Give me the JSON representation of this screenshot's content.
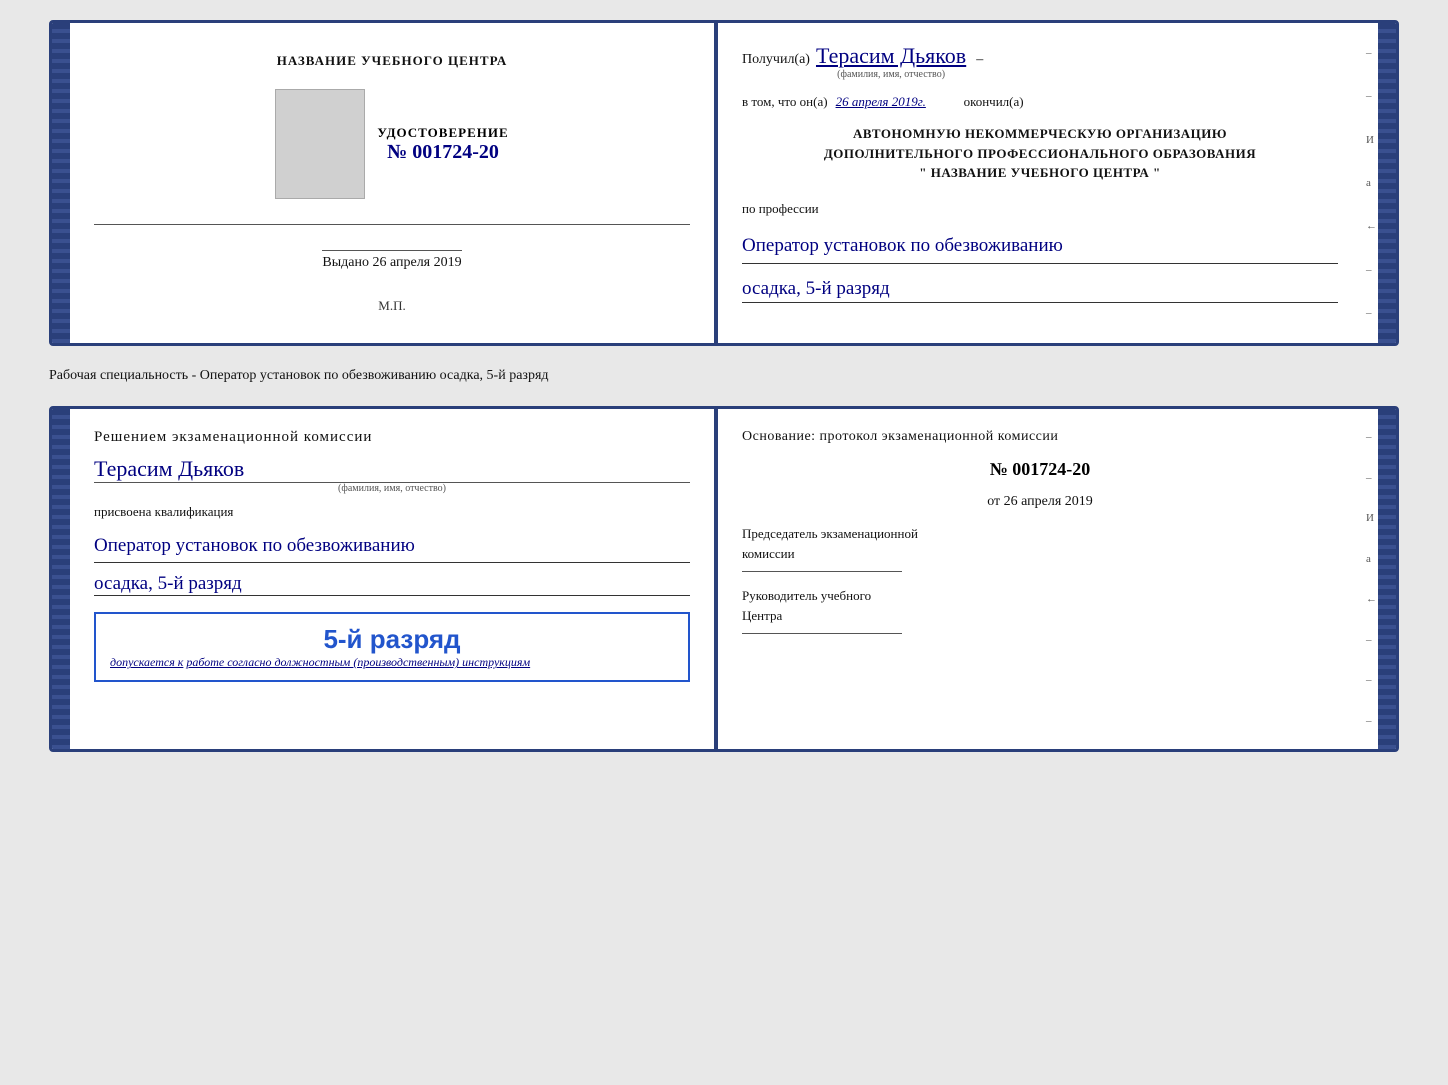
{
  "top_doc": {
    "left": {
      "center_title": "НАЗВАНИЕ УЧЕБНОГО ЦЕНТРА",
      "udost_label": "УДОСТОВЕРЕНИЕ",
      "udost_number": "№ 001724-20",
      "vydano_prefix": "Выдано",
      "vydano_date": "26 апреля 2019",
      "mp_label": "М.П."
    },
    "right": {
      "poluchil": "Получил(а)",
      "name": "Терасим Дьяков",
      "fio_hint": "(фамилия, имя, отчество)",
      "vtom_prefix": "в том, что он(а)",
      "vtom_date": "26 апреля 2019г.",
      "okonchil": "окончил(а)",
      "avtonom_line1": "АВТОНОМНУЮ НЕКОММЕРЧЕСКУЮ ОРГАНИЗАЦИЮ",
      "avtonom_line2": "ДОПОЛНИТЕЛЬНОГО ПРОФЕССИОНАЛЬНОГО ОБРАЗОВАНИЯ",
      "avtonom_line3": "\"  НАЗВАНИЕ УЧЕБНОГО ЦЕНТРА  \"",
      "po_professii": "по профессии",
      "profession": "Оператор установок по обезвоживанию",
      "razryad": "осадка, 5-й разряд"
    }
  },
  "middle_label": "Рабочая специальность - Оператор установок по обезвоживанию осадка, 5-й разряд",
  "bottom_doc": {
    "left": {
      "resheniem": "Решением экзаменационной комиссии",
      "name": "Терасим Дьяков",
      "fio_hint": "(фамилия, имя, отчество)",
      "prisvoena": "присвоена квалификация",
      "qualification": "Оператор установок по обезвоживанию",
      "razryad": "осадка, 5-й разряд",
      "stamp_text": "5-й разряд",
      "dopuskaetsya_prefix": "допускается к",
      "dopuskaetsya_underline": "работе согласно должностным (производственным) инструкциям"
    },
    "right": {
      "osnovanie": "Основание: протокол экзаменационной комиссии",
      "protokol_number": "№ 001724-20",
      "ot_prefix": "от",
      "ot_date": "26 апреля 2019",
      "predsedatel_line1": "Председатель экзаменационной",
      "predsedatel_line2": "комиссии",
      "rukovoditel_line1": "Руководитель учебного",
      "rukovoditel_line2": "Центра"
    }
  },
  "margin_items": [
    "И",
    "а",
    "←",
    "–",
    "–",
    "–",
    "–"
  ]
}
